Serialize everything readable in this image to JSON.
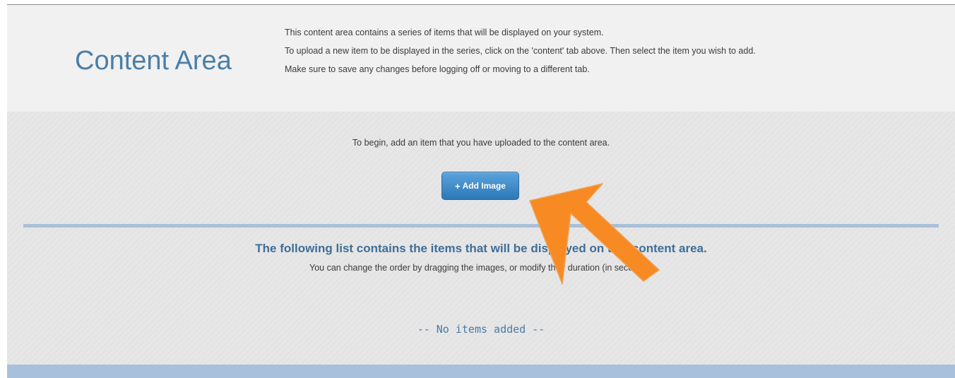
{
  "header": {
    "title": "Content Area",
    "description": [
      "This content area contains a series of items that will be displayed on your system.",
      "To upload a new item to be displayed in the series, click on the 'content' tab above. Then select the item you wish to add.",
      "Make sure to save any changes before logging off or moving to a different tab."
    ]
  },
  "main": {
    "intro_text": "To begin, add an item that you have uploaded to the content area.",
    "add_button": {
      "icon": "+",
      "label": "Add Image"
    },
    "list_heading": "The following list contains the items that will be displayed on this content area.",
    "list_subtext": "You can change the order by dragging the images, or modify their duration (in seconds).",
    "empty_message": "-- No items added --"
  },
  "colors": {
    "accent": "#4a7fa8",
    "button": "#3a88c8",
    "annotation_arrow": "#f78a22",
    "divider": "#a9c0d8"
  },
  "annotation": {
    "icon": "arrow-annotation-icon"
  }
}
